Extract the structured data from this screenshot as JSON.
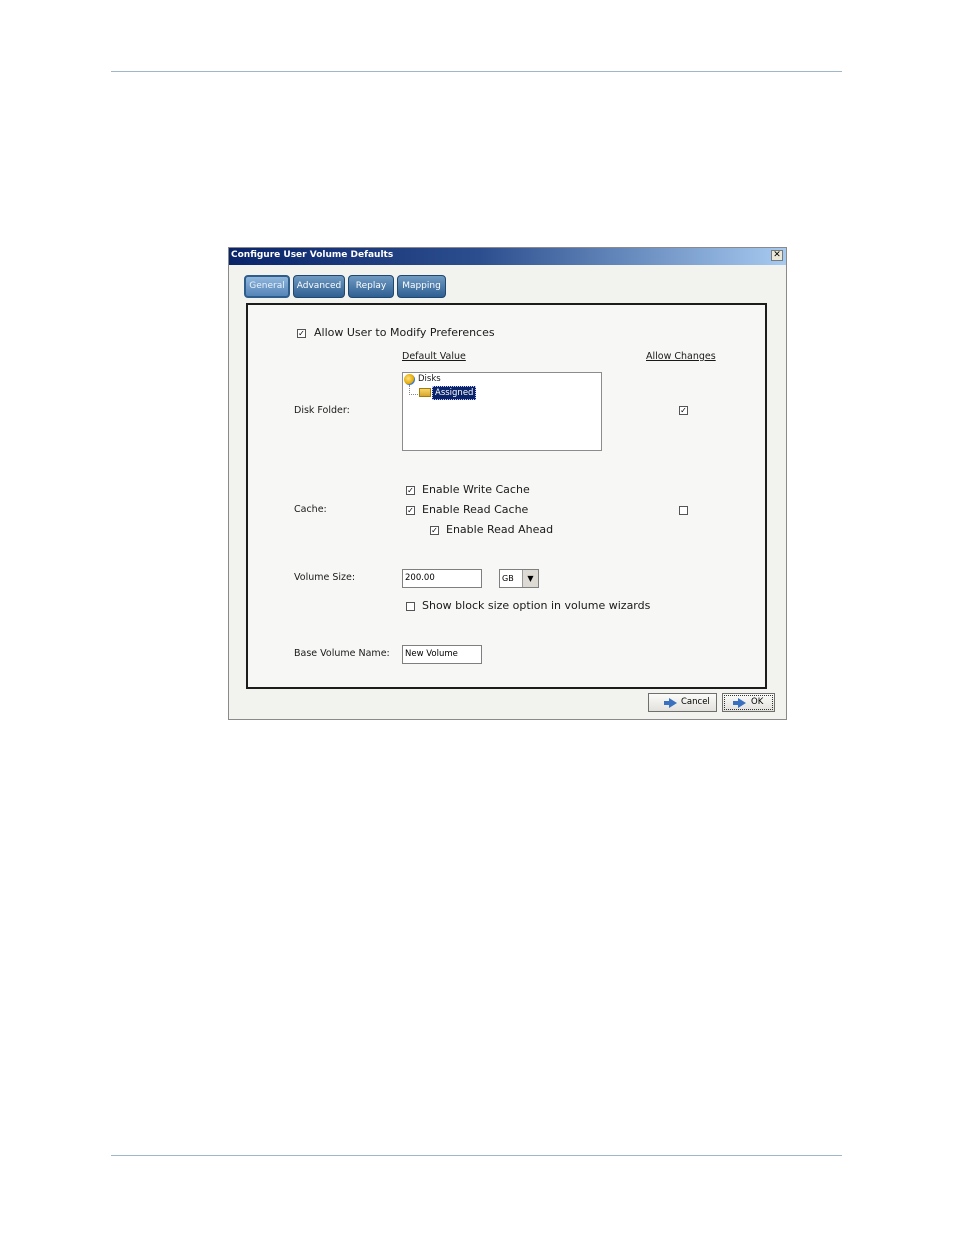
{
  "dialog": {
    "title": "Configure User Volume Defaults",
    "close_glyph": "✕"
  },
  "tabs": [
    {
      "label": "General",
      "active": true
    },
    {
      "label": "Advanced",
      "active": false
    },
    {
      "label": "Replay",
      "active": false
    },
    {
      "label": "Mapping",
      "active": false
    }
  ],
  "general": {
    "allow_modify": {
      "label": "Allow User to Modify Preferences",
      "checked": true
    },
    "headers": {
      "default_value": "Default Value",
      "allow_changes": "Allow Changes"
    },
    "disk_folder": {
      "label": "Disk Folder:",
      "tree": {
        "root": "Disks",
        "child": "Assigned",
        "selected": "Assigned"
      },
      "allow_changes_checked": true
    },
    "cache": {
      "label": "Cache:",
      "write": {
        "label": "Enable Write Cache",
        "checked": true
      },
      "read": {
        "label": "Enable Read Cache",
        "checked": true
      },
      "read_ahead": {
        "label": "Enable Read Ahead",
        "checked": true
      },
      "allow_changes_checked": false
    },
    "volume_size": {
      "label": "Volume Size:",
      "value": "200.00",
      "unit": "GB",
      "show_block": {
        "label": "Show block size option in volume wizards",
        "checked": false
      }
    },
    "base_volume_name": {
      "label": "Base Volume Name:",
      "value": "New Volume"
    }
  },
  "buttons": {
    "cancel": "Cancel",
    "ok": "OK"
  },
  "check_glyph": "✓",
  "colors": {
    "tab_blue": "#2f5f92",
    "titlebar": "#0a246a",
    "selection": "#0a246a"
  }
}
